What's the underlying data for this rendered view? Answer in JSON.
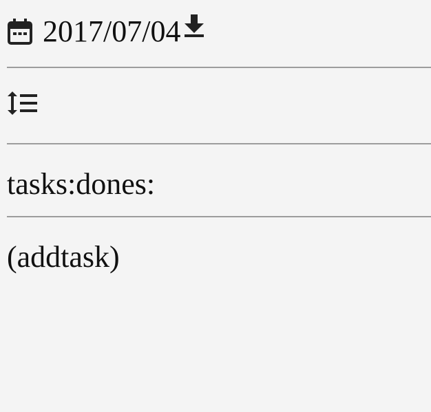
{
  "header": {
    "date": "2017/07/04",
    "calendar_icon": "calendar-icon",
    "download_icon": "download-icon"
  },
  "toolbar": {
    "sort_icon": "sort-list-icon"
  },
  "tasks": {
    "summary_label": "tasks:dones:"
  },
  "actions": {
    "add_task_label": "(addtask)"
  }
}
